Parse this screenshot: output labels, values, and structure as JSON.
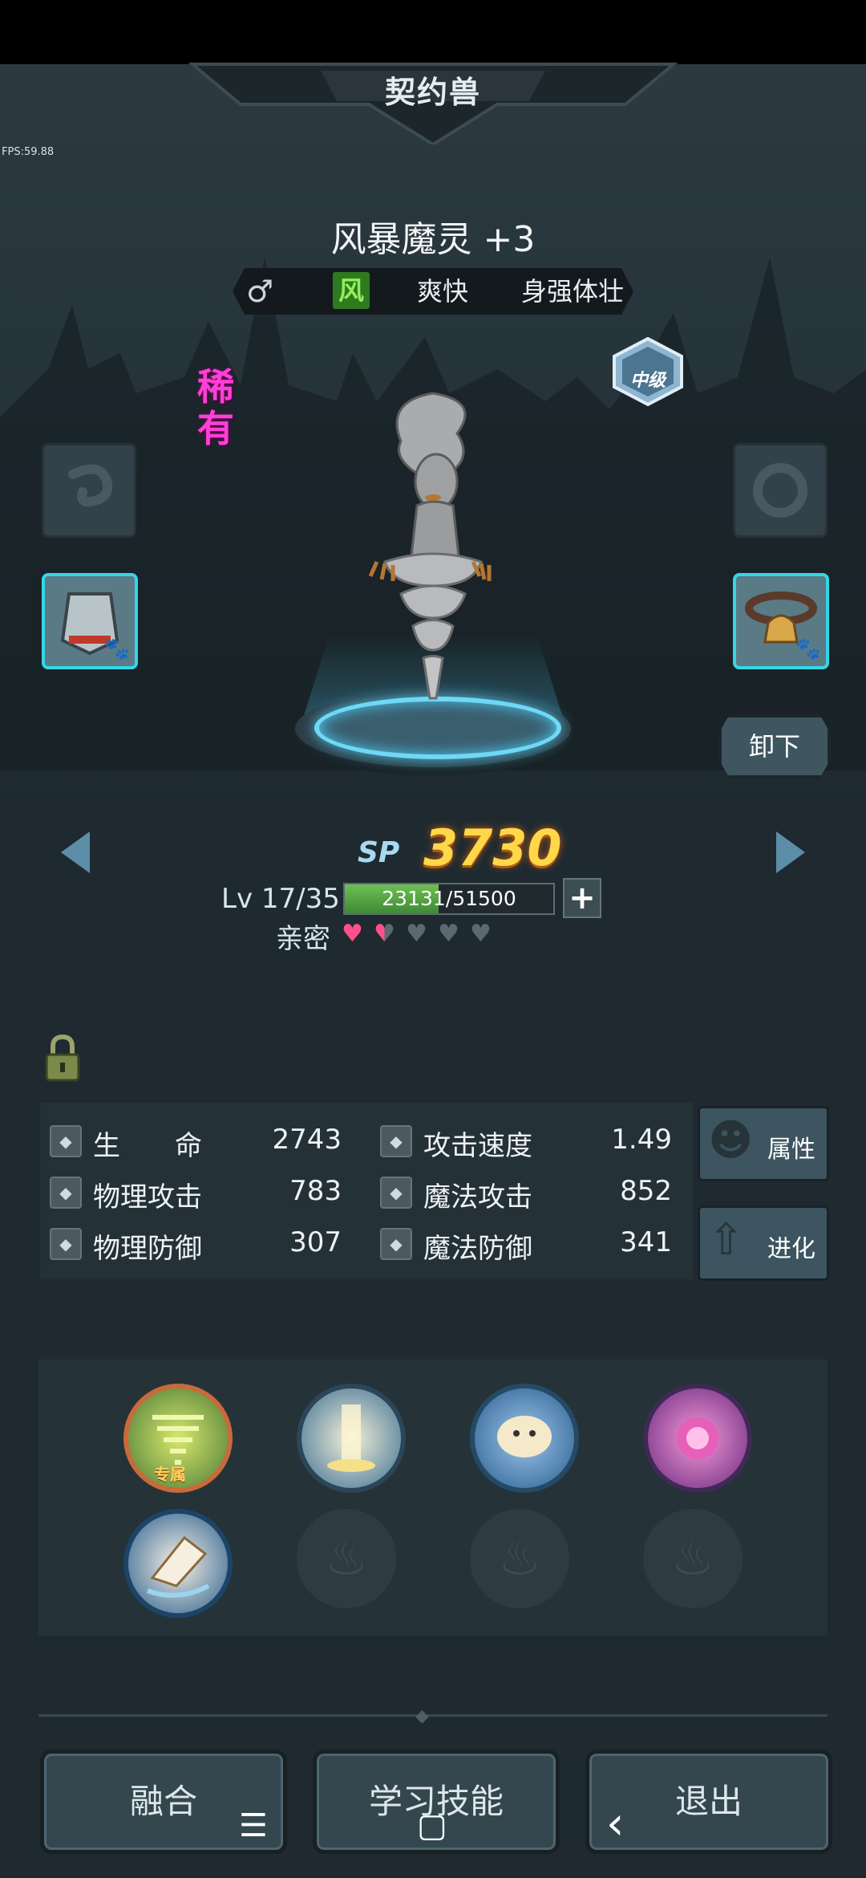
{
  "header": {
    "title": "契约兽",
    "fps": "FPS:59.88"
  },
  "pet": {
    "name": "风暴魔灵 +3",
    "traits": {
      "gender": "♂",
      "element": "风",
      "personality": "爽快",
      "attribute": "身强体壮"
    },
    "rarity": "稀有",
    "tier": "中级",
    "unequip_label": "卸下"
  },
  "progress": {
    "sp_label": "SP",
    "sp_value": "3730",
    "level_text": "Lv 17/35",
    "exp_text": "23131/51500",
    "exp_fraction": 0.449,
    "exp_plus": "+",
    "intimacy_label": "亲密",
    "intimacy_hearts": 1.5,
    "intimacy_max": 5
  },
  "stats": [
    {
      "icon": "heart-stat-icon",
      "label": "生　　命",
      "value": "2743"
    },
    {
      "icon": "attack-speed-icon",
      "label": "攻击速度",
      "value": "1.49"
    },
    {
      "icon": "physical-attack-icon",
      "label": "物理攻击",
      "value": "783"
    },
    {
      "icon": "magic-attack-icon",
      "label": "魔法攻击",
      "value": "852"
    },
    {
      "icon": "physical-defense-icon",
      "label": "物理防御",
      "value": "307"
    },
    {
      "icon": "magic-defense-icon",
      "label": "魔法防御",
      "value": "341"
    }
  ],
  "side_buttons": {
    "attributes": "属性",
    "evolve": "进化"
  },
  "skills": {
    "exclusive_tag": "专属",
    "slots": [
      "tornado-skill",
      "light-pillar-skill",
      "cloud-spirit-skill",
      "purple-burst-skill",
      "wind-blade-skill",
      "locked",
      "locked",
      "locked"
    ]
  },
  "bottom_buttons": {
    "fuse": "融合",
    "learn_skill": "学习技能",
    "exit": "退出"
  },
  "nav": {
    "menu": "☰",
    "home": "▢",
    "back": "‹"
  },
  "colors": {
    "rarity": "#ff3fd6",
    "sp": "#ffd84a",
    "slot_border": "#33d7e7",
    "element_bg": "#2f7a1f"
  }
}
